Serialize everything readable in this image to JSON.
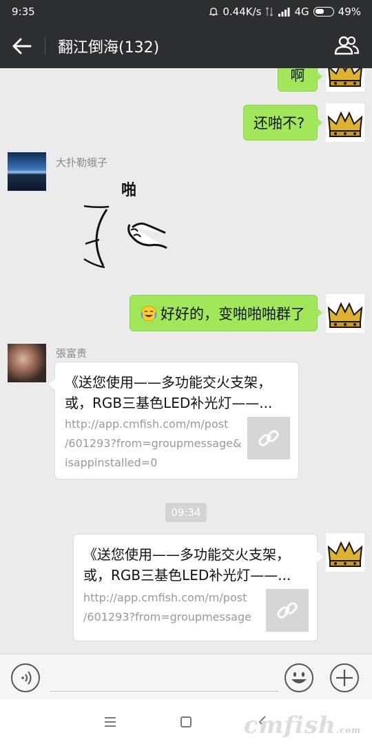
{
  "status_bar": {
    "time": "9:35",
    "network_speed": "0.44K/s",
    "network_type": "4G",
    "battery": "49%"
  },
  "title_bar": {
    "title": "翻江倒海(132)",
    "back_icon": "arrow-left-icon",
    "members_icon": "group-members-icon"
  },
  "messages": {
    "msg1_text": "啊",
    "msg2_text": "还啪不?",
    "sender1_name": "大扑勒蛾子",
    "sticker_text": "啪",
    "msg3_text": "好好的，变啪啪啪群了",
    "sender2_name": "張富贵",
    "card1": {
      "title": "《送您使用——多功能交火支架，\n或，RGB三基色LED补光灯——...",
      "url": "http://app.cmfish.com/m/post\n/601293?from=groupmessage&\nisappinstalled=0"
    },
    "timestamp": "09:34",
    "card2": {
      "title": "《送您使用——多功能交火支架，\n或，RGB三基色LED补光灯——...",
      "url": "http://app.cmfish.com/m/post\n/601293?from=groupmessage"
    }
  },
  "input_bar": {
    "voice_icon": "voice-icon",
    "emoji_icon": "emoji-icon",
    "plus_icon": "plus-icon",
    "placeholder": ""
  },
  "nav_bar": {
    "menu_icon": "menu-icon",
    "home_icon": "home-square-icon",
    "back_icon": "nav-back-icon",
    "watermark": "cmfish",
    "watermark_suffix": ".com"
  },
  "colors": {
    "bar_dark": "#2c2f31",
    "chat_bg": "#ebebeb",
    "bubble_green": "#a0e75a"
  }
}
